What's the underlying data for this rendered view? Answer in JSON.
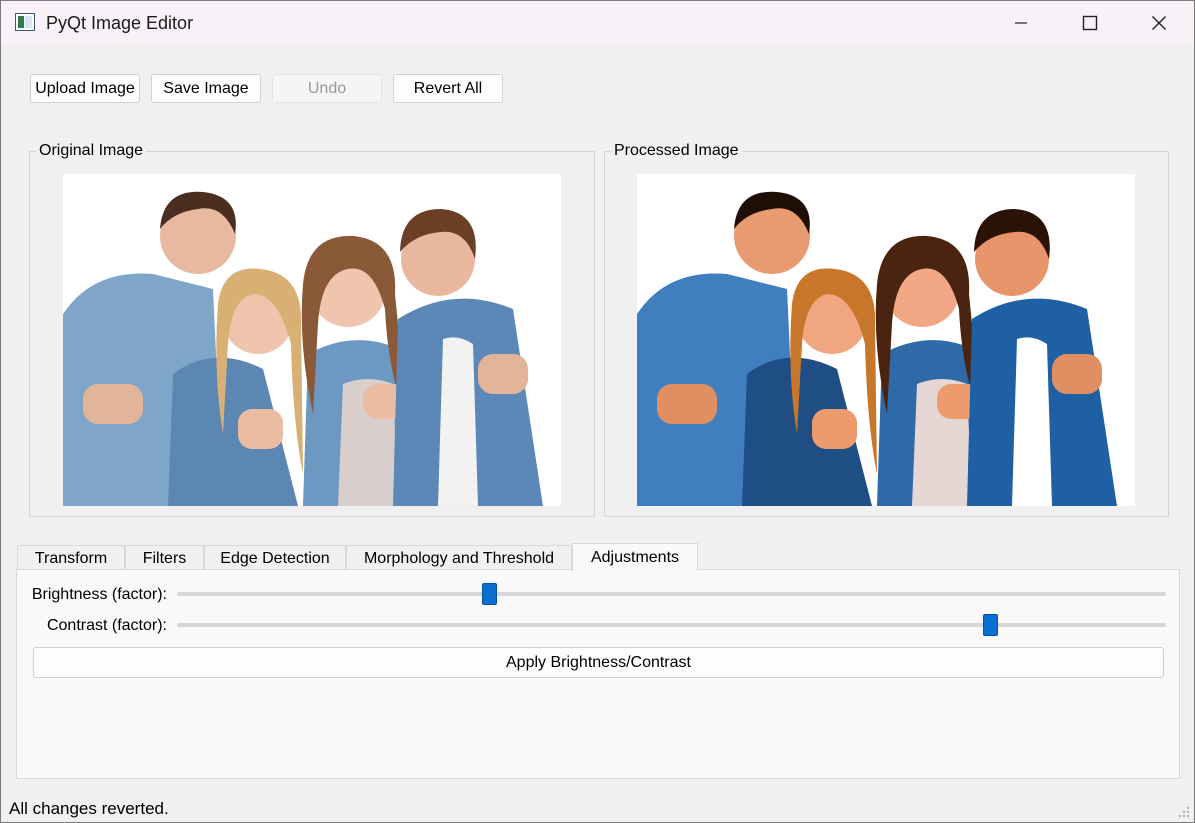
{
  "window": {
    "title": "PyQt Image Editor",
    "icon": "app-window-icon"
  },
  "toolbar": {
    "upload_label": "Upload Image",
    "save_label": "Save Image",
    "undo_label": "Undo",
    "undo_enabled": false,
    "revert_label": "Revert All"
  },
  "panels": {
    "original_title": "Original Image",
    "processed_title": "Processed Image"
  },
  "tabs": [
    {
      "label": "Transform",
      "active": false
    },
    {
      "label": "Filters",
      "active": false
    },
    {
      "label": "Edge Detection",
      "active": false
    },
    {
      "label": "Morphology and Threshold",
      "active": false
    },
    {
      "label": "Adjustments",
      "active": true
    }
  ],
  "adjustments": {
    "brightness_label": "Brightness (factor):",
    "brightness_position": 0.313,
    "contrast_label": "Contrast (factor):",
    "contrast_position": 0.828,
    "apply_label": "Apply Brightness/Contrast"
  },
  "status": {
    "text": "All changes reverted."
  },
  "colors": {
    "accent": "#0a6fd0",
    "window_bg": "#f0f0f0",
    "titlebar_bg": "#f8f1f8"
  }
}
